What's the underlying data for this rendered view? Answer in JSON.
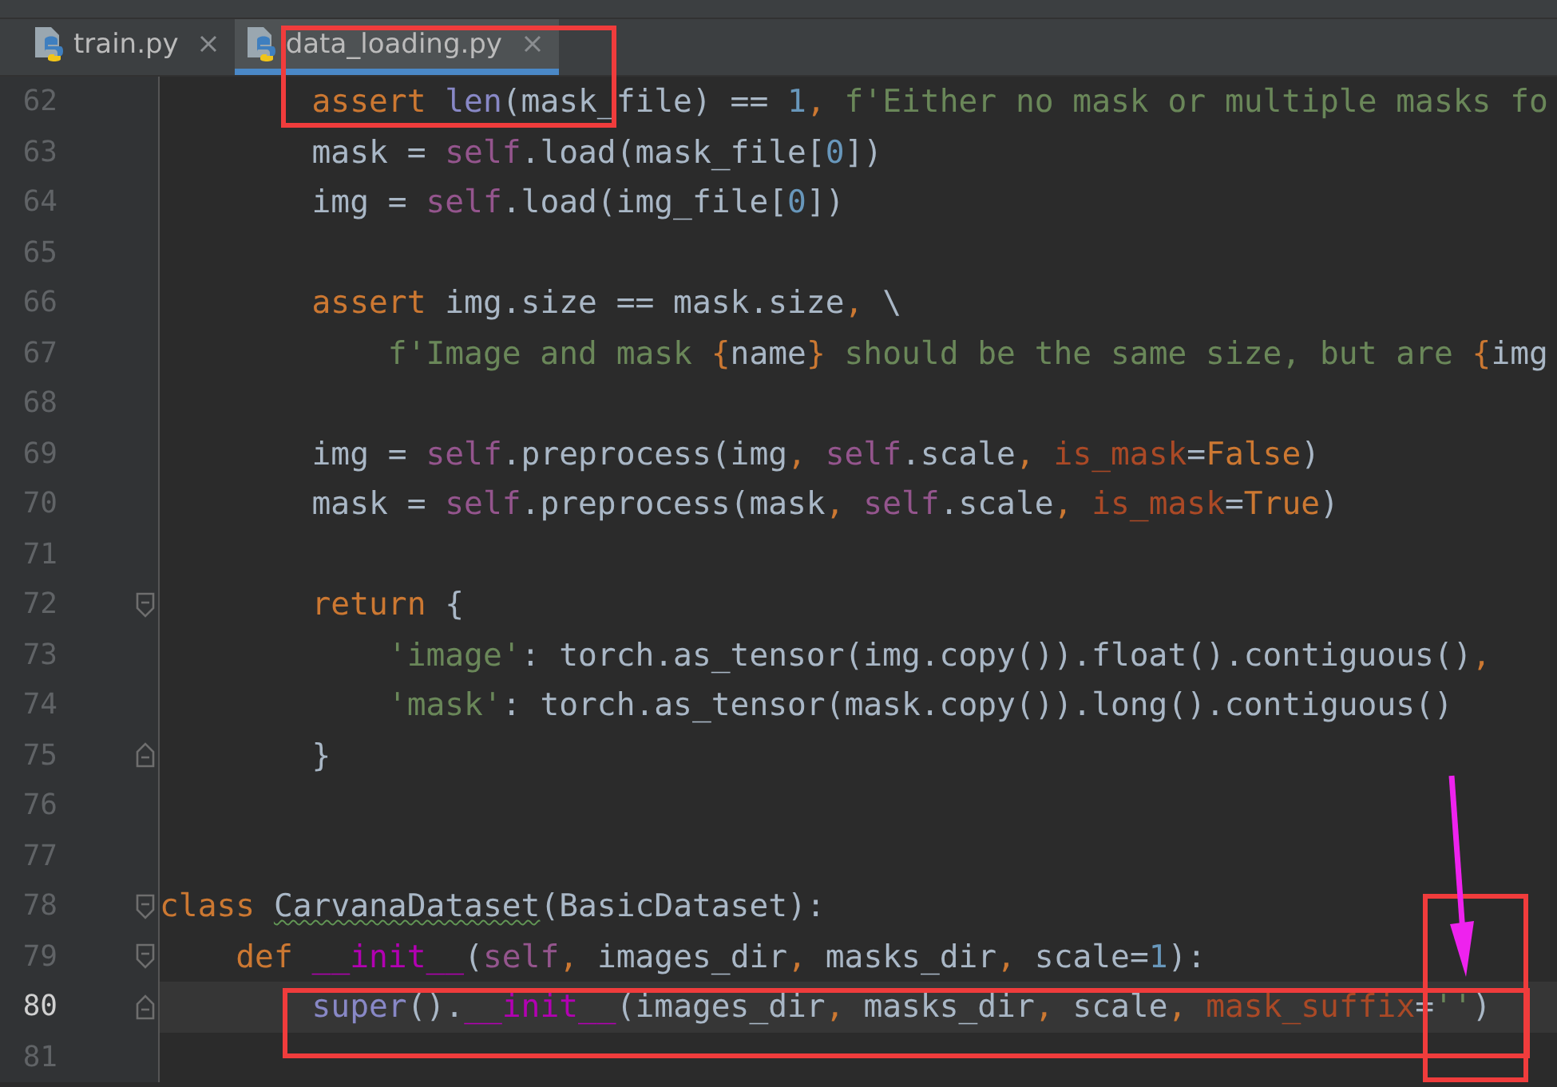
{
  "tabs": [
    {
      "label": "train.py",
      "selected": false
    },
    {
      "label": "data_loading.py",
      "selected": true
    }
  ],
  "lines": [
    {
      "number": "62",
      "current": false,
      "kind": "plain",
      "tokens": [
        {
          "kind": "kw",
          "text": "        assert"
        },
        {
          "kind": "builtin",
          "text": " len"
        },
        {
          "kind": "plain",
          "text": "(mask_file) == "
        },
        {
          "kind": "num",
          "text": "1"
        },
        {
          "kind": "comma",
          "text": ","
        },
        {
          "kind": "str",
          "text": " f'Either no mask or multiple masks fo"
        }
      ]
    },
    {
      "number": "63",
      "current": false,
      "kind": "plain",
      "tokens": [
        {
          "kind": "plain",
          "text": "        mask = "
        },
        {
          "kind": "self",
          "text": "self"
        },
        {
          "kind": "plain",
          "text": ".load(mask_file["
        },
        {
          "kind": "num",
          "text": "0"
        },
        {
          "kind": "plain",
          "text": "])"
        }
      ]
    },
    {
      "number": "64",
      "current": false,
      "kind": "plain",
      "tokens": [
        {
          "kind": "plain",
          "text": "        img = "
        },
        {
          "kind": "self",
          "text": "self"
        },
        {
          "kind": "plain",
          "text": ".load(img_file["
        },
        {
          "kind": "num",
          "text": "0"
        },
        {
          "kind": "plain",
          "text": "])"
        }
      ]
    },
    {
      "number": "65",
      "current": false,
      "kind": "plain"
    },
    {
      "number": "66",
      "current": false,
      "kind": "plain",
      "tokens": [
        {
          "kind": "kw",
          "text": "        assert"
        },
        {
          "kind": "plain",
          "text": " img.size == mask.size"
        },
        {
          "kind": "comma",
          "text": ","
        },
        {
          "kind": "plain",
          "text": " \\"
        }
      ]
    },
    {
      "number": "67",
      "current": false,
      "kind": "plain",
      "tokens": [
        {
          "kind": "str",
          "text": "            f'Image and mask "
        },
        {
          "kind": "fbrace",
          "text": "{"
        },
        {
          "kind": "plain",
          "text": "name"
        },
        {
          "kind": "fbrace",
          "text": "}"
        },
        {
          "kind": "str",
          "text": " should be the same size, but are "
        },
        {
          "kind": "fbrace",
          "text": "{"
        },
        {
          "kind": "plain",
          "text": "img"
        }
      ]
    },
    {
      "number": "68",
      "current": false,
      "kind": "plain"
    },
    {
      "number": "69",
      "current": false,
      "kind": "plain",
      "tokens": [
        {
          "kind": "plain",
          "text": "        img = "
        },
        {
          "kind": "self",
          "text": "self"
        },
        {
          "kind": "plain",
          "text": ".preprocess(img"
        },
        {
          "kind": "comma",
          "text": ","
        },
        {
          "kind": "self",
          "text": " self"
        },
        {
          "kind": "plain",
          "text": ".scale"
        },
        {
          "kind": "comma",
          "text": ","
        },
        {
          "kind": "param",
          "text": " is_mask"
        },
        {
          "kind": "plain",
          "text": "="
        },
        {
          "kind": "kw",
          "text": "False"
        },
        {
          "kind": "plain",
          "text": ")"
        }
      ]
    },
    {
      "number": "70",
      "current": false,
      "kind": "plain",
      "tokens": [
        {
          "kind": "plain",
          "text": "        mask = "
        },
        {
          "kind": "self",
          "text": "self"
        },
        {
          "kind": "plain",
          "text": ".preprocess(mask"
        },
        {
          "kind": "comma",
          "text": ","
        },
        {
          "kind": "self",
          "text": " self"
        },
        {
          "kind": "plain",
          "text": ".scale"
        },
        {
          "kind": "comma",
          "text": ","
        },
        {
          "kind": "param",
          "text": " is_mask"
        },
        {
          "kind": "plain",
          "text": "="
        },
        {
          "kind": "kw",
          "text": "True"
        },
        {
          "kind": "plain",
          "text": ")"
        }
      ]
    },
    {
      "number": "71",
      "current": false,
      "kind": "plain"
    },
    {
      "number": "72",
      "current": false,
      "kind": "fold_start",
      "tokens": [
        {
          "kind": "kw",
          "text": "        return"
        },
        {
          "kind": "plain",
          "text": " {"
        }
      ]
    },
    {
      "number": "73",
      "current": false,
      "kind": "plain",
      "tokens": [
        {
          "kind": "str",
          "text": "            'image'"
        },
        {
          "kind": "plain",
          "text": ": torch.as_tensor(img.copy()).float().contiguous()"
        },
        {
          "kind": "comma",
          "text": ","
        }
      ]
    },
    {
      "number": "74",
      "current": false,
      "kind": "plain",
      "tokens": [
        {
          "kind": "str",
          "text": "            'mask'"
        },
        {
          "kind": "plain",
          "text": ": torch.as_tensor(mask.copy()).long().contiguous()"
        }
      ]
    },
    {
      "number": "75",
      "current": false,
      "kind": "fold_end",
      "tokens": [
        {
          "kind": "plain",
          "text": "        }"
        }
      ]
    },
    {
      "number": "76",
      "current": false,
      "kind": "plain"
    },
    {
      "number": "77",
      "current": false,
      "kind": "plain"
    },
    {
      "number": "78",
      "current": false,
      "kind": "fold_start",
      "tokens": [
        {
          "kind": "kw",
          "text": "class "
        },
        {
          "kind": "plain",
          "text": "CarvanaDataset",
          "typo": true
        },
        {
          "kind": "plain",
          "text": "(BasicDataset):"
        }
      ]
    },
    {
      "number": "79",
      "current": false,
      "kind": "fold_start",
      "tokens": [
        {
          "kind": "kw",
          "text": "    def"
        },
        {
          "kind": "magic",
          "text": " __init__"
        },
        {
          "kind": "plain",
          "text": "("
        },
        {
          "kind": "self",
          "text": "self"
        },
        {
          "kind": "comma",
          "text": ","
        },
        {
          "kind": "plain",
          "text": " images_dir"
        },
        {
          "kind": "comma",
          "text": ","
        },
        {
          "kind": "plain",
          "text": " masks_dir"
        },
        {
          "kind": "comma",
          "text": ","
        },
        {
          "kind": "plain",
          "text": " scale="
        },
        {
          "kind": "num",
          "text": "1"
        },
        {
          "kind": "plain",
          "text": "):"
        }
      ]
    },
    {
      "number": "80",
      "current": true,
      "kind": "fold_end",
      "tokens": [
        {
          "kind": "builtin",
          "text": "        super"
        },
        {
          "kind": "plain",
          "text": "()."
        },
        {
          "kind": "magic",
          "text": "__init__"
        },
        {
          "kind": "plain",
          "text": "(images_dir"
        },
        {
          "kind": "comma",
          "text": ","
        },
        {
          "kind": "plain",
          "text": " masks_dir"
        },
        {
          "kind": "comma",
          "text": ","
        },
        {
          "kind": "plain",
          "text": " scale"
        },
        {
          "kind": "comma",
          "text": ","
        },
        {
          "kind": "param",
          "text": " mask_suffix"
        },
        {
          "kind": "plain",
          "text": "="
        },
        {
          "kind": "str",
          "text": "''"
        },
        {
          "kind": "plain",
          "text": ")"
        }
      ]
    },
    {
      "number": "81",
      "current": false,
      "kind": "plain"
    }
  ],
  "annotations": [
    {
      "kind": "box",
      "color": "#f03c3c"
    },
    {
      "kind": "box",
      "color": "#f03c3c"
    },
    {
      "kind": "box",
      "color": "#f03c3c"
    },
    {
      "kind": "arrow",
      "color": "#ee22ee"
    }
  ]
}
